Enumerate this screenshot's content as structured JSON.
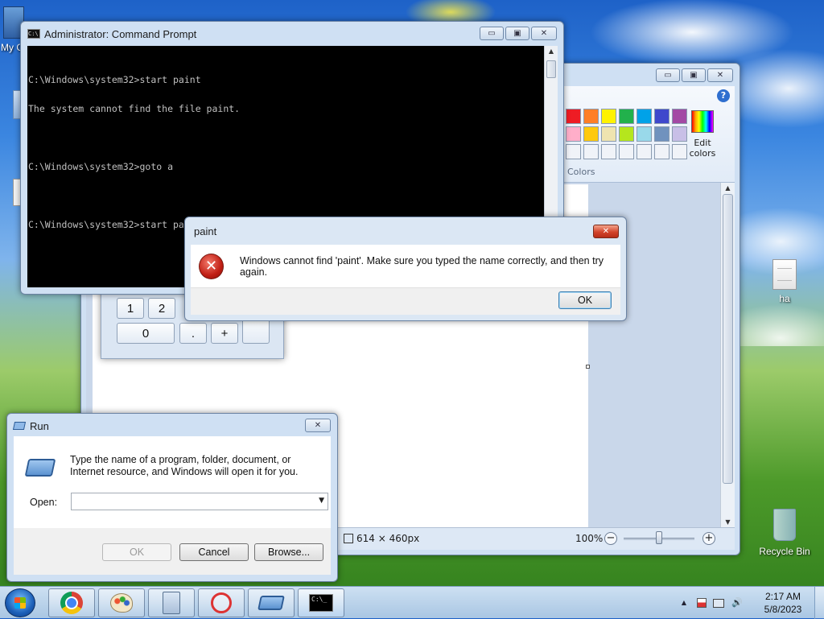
{
  "desktop": {
    "icons": [
      {
        "label": "My C"
      },
      {
        "label": "ha"
      },
      {
        "label": "Recycle Bin"
      }
    ]
  },
  "paint": {
    "help": "?",
    "palette": [
      "#ee1c24",
      "#ff7f27",
      "#fff200",
      "#22b14c",
      "#00a2e8",
      "#3f48cc",
      "#a349a4",
      "#ffaec9",
      "#ffc90e",
      "#efe4b0",
      "#b5e61d",
      "#99d9ea",
      "#7092be",
      "#c8bfe7",
      "#f0f3f8",
      "#f0f3f8",
      "#f0f3f8",
      "#f0f3f8",
      "#f0f3f8",
      "#f0f3f8",
      "#f0f3f8"
    ],
    "edit_colors": "Edit colors",
    "colors_group": "Colors",
    "status": {
      "dimensions": "614 × 460px",
      "zoom": "100%",
      "minus": "−",
      "plus": "+"
    }
  },
  "calculator": {
    "keys": [
      "1",
      "2",
      "0",
      ".",
      "+"
    ]
  },
  "cmd": {
    "title": "Administrator: Command Prompt",
    "icon_text": "C:\\",
    "lines": [
      "C:\\Windows\\system32>start paint",
      "The system cannot find the file paint.",
      "",
      "C:\\Windows\\system32>goto a",
      "",
      "C:\\Windows\\system32>start paint"
    ]
  },
  "error": {
    "title": "paint",
    "message": "Windows cannot find 'paint'. Make sure you typed the name correctly, and then try again.",
    "ok": "OK",
    "icon_glyph": "✕"
  },
  "run": {
    "title": "Run",
    "description": "Type the name of a program, folder, document, or Internet resource, and Windows will open it for you.",
    "open_label": "Open:",
    "open_value": "",
    "ok": "OK",
    "cancel": "Cancel",
    "browse": "Browse..."
  },
  "taskbar": {
    "clock_time": "2:17 AM",
    "clock_date": "5/8/2023",
    "tray_up": "▲",
    "cmd_icon_text": "C:\\_"
  },
  "caption": {
    "min": "▭",
    "max": "▣",
    "close": "✕"
  }
}
